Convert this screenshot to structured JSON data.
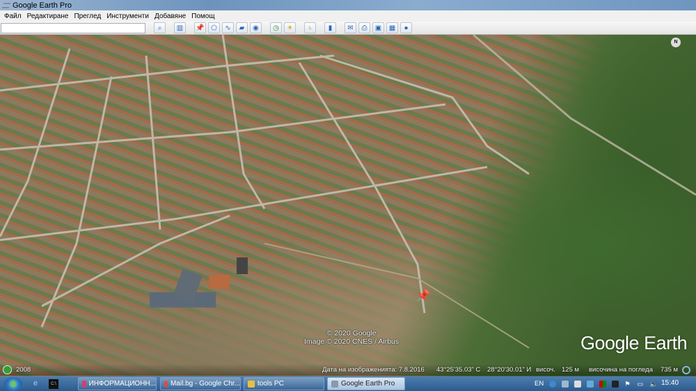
{
  "window": {
    "title": "Google Earth Pro"
  },
  "menu": [
    "Файл",
    "Редактиране",
    "Преглед",
    "Инструменти",
    "Добавяне",
    "Помощ"
  ],
  "search": {
    "value": "",
    "placeholder": ""
  },
  "toolbar": [
    "search-icon",
    "sidebar-icon",
    "placemark-icon",
    "polygon-icon",
    "path-icon",
    "overlay-icon",
    "tour-icon",
    "historical-imagery-icon",
    "sunlight-icon",
    "planets-icon",
    "ruler-icon",
    "email-icon",
    "print-icon",
    "save-image-icon",
    "maps-icon",
    "earth-icon"
  ],
  "map": {
    "compass": "N",
    "copyright": [
      "© 2020 Google",
      "Image © 2020 CNES / Airbus"
    ],
    "logo": "Google Earth",
    "history_year": "2008",
    "status": {
      "date": "Дата на изображенията: 7.8.2016",
      "lat": "43°25'35.03\" С",
      "lon": "28°20'30.01\" И",
      "elev_label": "височ.",
      "elev": "125 м",
      "eye_label": "височина на погледа",
      "eye": "735 м"
    }
  },
  "taskbar": {
    "items": [
      "ИНФОРМАЦИОНН...",
      "Mail.bg - Google Chr...",
      "tools PC",
      "Google Earth Pro"
    ],
    "lang": "EN",
    "clock": "15:40"
  }
}
